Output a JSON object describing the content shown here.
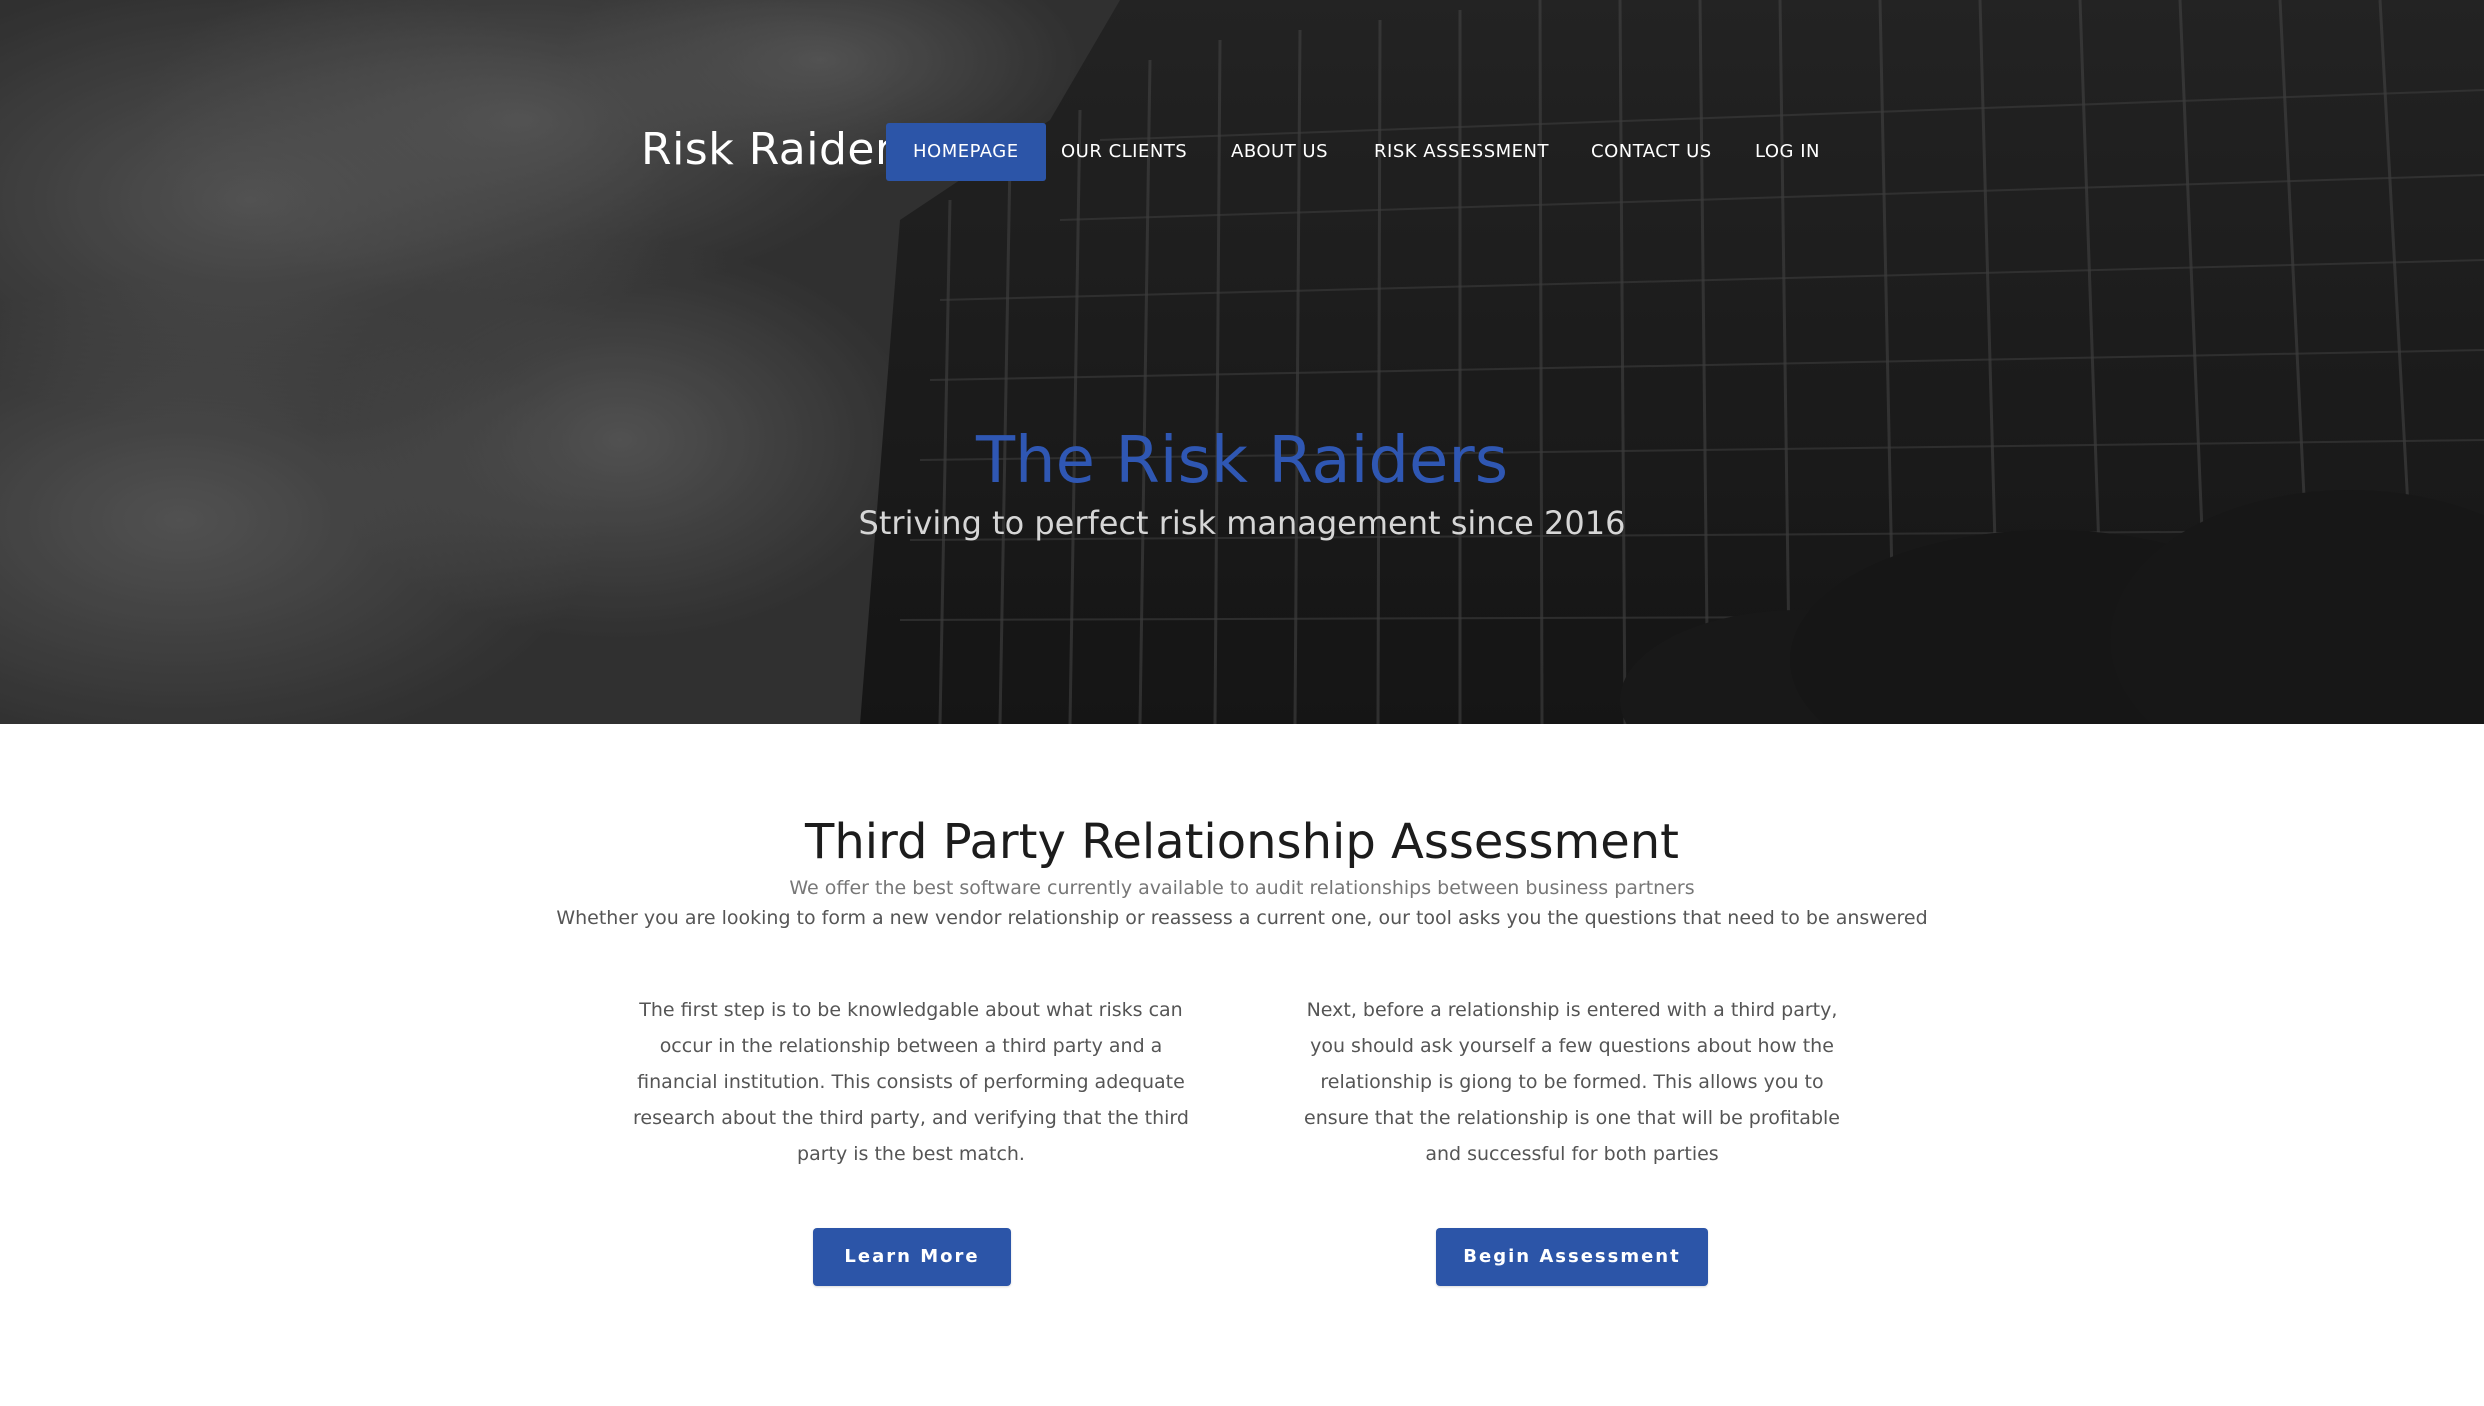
{
  "header": {
    "brand": "Risk Raiders",
    "nav": [
      {
        "label": "HOMEPAGE",
        "active": true
      },
      {
        "label": "OUR CLIENTS",
        "active": false
      },
      {
        "label": "ABOUT US",
        "active": false
      },
      {
        "label": "RISK ASSESSMENT",
        "active": false
      },
      {
        "label": "CONTACT US",
        "active": false
      },
      {
        "label": "LOG IN",
        "active": false
      }
    ]
  },
  "hero": {
    "title": "The Risk Raiders",
    "subtitle": "Striving to perfect risk management since 2016"
  },
  "main": {
    "title": "Third Party Relationship Assessment",
    "subtitle_1": "We offer the best software currently available to audit relationships between business partners",
    "subtitle_2": "Whether you are looking to form a new vendor relationship or reassess a current one, our tool asks you the questions that need to be answered",
    "columns": [
      {
        "text": "The first step is to be knowledgable about what risks can occur in the relationship between a third party and a financial institution. This consists of performing adequate research about the third party, and verifying that the third party is the best match.",
        "button": "Learn More"
      },
      {
        "text": "Next, before a relationship is entered with a third party, you should ask yourself a few questions about how the relationship is giong to be formed. This allows you to ensure that the relationship is one that will be profitable and successful for both parties",
        "button": "Begin Assessment"
      }
    ]
  },
  "colors": {
    "accent": "#2c55a8",
    "hero_title": "#2f57b3"
  }
}
